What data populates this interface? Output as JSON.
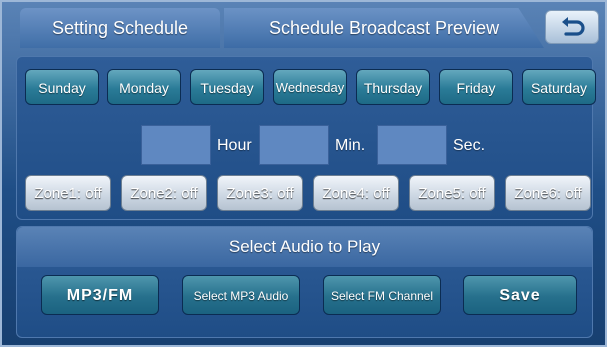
{
  "header": {
    "tabs": [
      {
        "label": "Setting Schedule"
      },
      {
        "label": "Schedule Broadcast Preview"
      }
    ],
    "back_icon": "back-arrow-icon"
  },
  "days": [
    {
      "label": "Sunday"
    },
    {
      "label": "Monday"
    },
    {
      "label": "Tuesday"
    },
    {
      "label": "Wednesday"
    },
    {
      "label": "Thursday"
    },
    {
      "label": "Friday"
    },
    {
      "label": "Saturday"
    }
  ],
  "time": {
    "hour_label": "Hour",
    "min_label": "Min.",
    "sec_label": "Sec.",
    "hour_value": "",
    "min_value": "",
    "sec_value": ""
  },
  "zones": [
    {
      "label": "Zone1: off"
    },
    {
      "label": "Zone2: off"
    },
    {
      "label": "Zone3: off"
    },
    {
      "label": "Zone4: off"
    },
    {
      "label": "Zone5: off"
    },
    {
      "label": "Zone6: off"
    }
  ],
  "audio": {
    "heading": "Select Audio to Play",
    "mp3fm_label": "MP3/FM",
    "select_mp3_label": "Select MP3 Audio",
    "select_fm_label": "Select FM Channel",
    "save_label": "Save"
  },
  "colors": {
    "background": "#1f4e86",
    "day_button": "#2a7b97",
    "zone_button": "#cbd6e2",
    "time_field": "#5f88c1"
  }
}
